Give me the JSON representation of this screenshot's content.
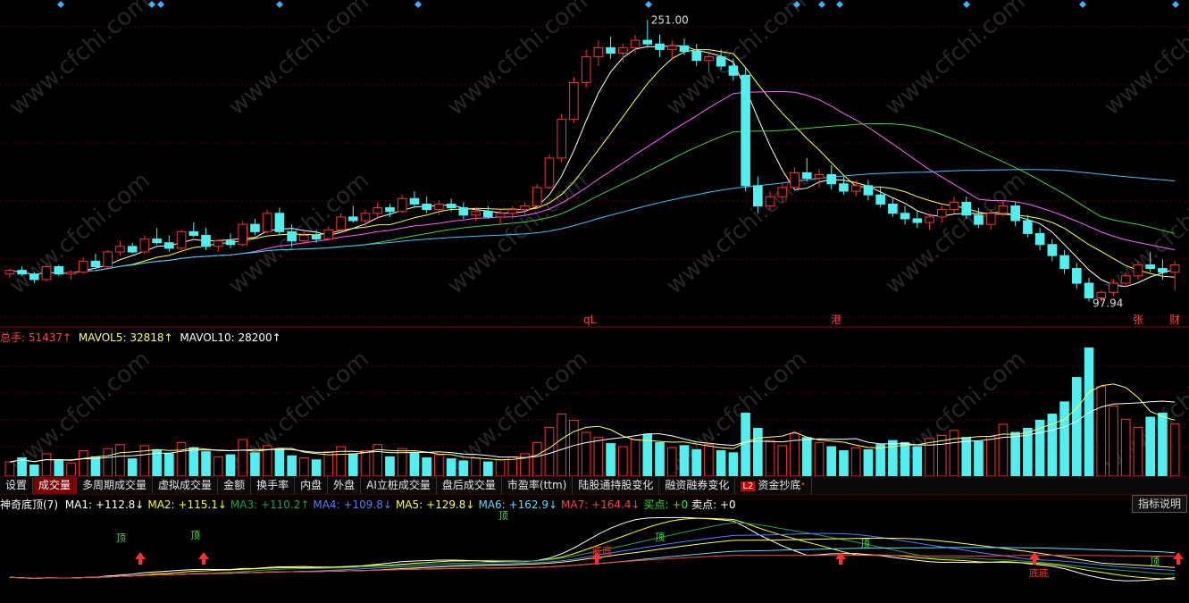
{
  "price_pane": {
    "high_label": "251.00",
    "low_label": "97.94",
    "markers": [
      {
        "text": "qL",
        "color": "#ff4040"
      },
      {
        "text": "港",
        "color": "#ff4040"
      },
      {
        "text": "张",
        "color": "#ff4040"
      },
      {
        "text": "财",
        "color": "#ff4040"
      }
    ]
  },
  "volume_legend": {
    "total": "总手: 51437↑",
    "mavol5": "MAVOL5: 32818↑",
    "mavol10": "MAVOL10: 28200↑",
    "colors": {
      "total": "#ff4040",
      "mavol5": "#ffff60",
      "mavol10": "#ffffff"
    }
  },
  "tabs": [
    {
      "label": "设置",
      "active": false
    },
    {
      "label": "成交量",
      "active": true
    },
    {
      "label": "多周期成交量",
      "active": false
    },
    {
      "label": "虚拟成交量",
      "active": false
    },
    {
      "label": "金额",
      "active": false
    },
    {
      "label": "换手率",
      "active": false
    },
    {
      "label": "内盘",
      "active": false
    },
    {
      "label": "外盘",
      "active": false
    },
    {
      "label": "AI立桩成交量",
      "active": false
    },
    {
      "label": "盘后成交量",
      "active": false
    },
    {
      "label": "市盈率(ttm)",
      "active": false
    },
    {
      "label": "陆股通持股变化",
      "active": false
    },
    {
      "label": "融资融券变化",
      "active": false
    },
    {
      "label": "资金抄底",
      "active": false,
      "badge": "L2",
      "dot": "•"
    }
  ],
  "indicator_legend": {
    "name": "神奇底顶(7)",
    "items": [
      {
        "text": "MA1: +112.8↓",
        "color": "#ffffff"
      },
      {
        "text": "MA2: +115.1↓",
        "color": "#ffff00"
      },
      {
        "text": "MA3: +110.2↑",
        "color": "#1aa05a"
      },
      {
        "text": "MA4: +109.8↓",
        "color": "#5a7bff"
      },
      {
        "text": "MA5: +129.8↓",
        "color": "#ffff60"
      },
      {
        "text": "MA6: +162.9↓",
        "color": "#60d8ff"
      },
      {
        "text": "MA7: +164.4↓",
        "color": "#ff4040"
      },
      {
        "text": "买点: +0",
        "color": "#40e040"
      },
      {
        "text": "卖点: +0",
        "color": "#ffffff"
      }
    ],
    "help_label": "指标说明"
  },
  "signal_labels": {
    "top": "顶",
    "bottom": "底",
    "bottom2": "底底"
  },
  "watermark": "www.cfchi.com",
  "colors": {
    "up": "#ff3030",
    "down": "#50f0f0",
    "ma5": "#ffffff",
    "ma10": "#ffff40",
    "ma20": "#ff60ff",
    "ma30": "#40d040",
    "ma60": "#40c0ff",
    "grid": "#5a0000"
  },
  "chart_data": [
    {
      "type": "candlestick",
      "xlabel": "",
      "ylabel": "",
      "ylim": [
        92,
        258
      ],
      "candles": [
        [
          113,
          116,
          111,
          115
        ],
        [
          115,
          117,
          112,
          113
        ],
        [
          113,
          114,
          108,
          110
        ],
        [
          110,
          118,
          109,
          117
        ],
        [
          117,
          118,
          112,
          113
        ],
        [
          113,
          115,
          110,
          114
        ],
        [
          114,
          122,
          113,
          120
        ],
        [
          120,
          124,
          116,
          117
        ],
        [
          117,
          126,
          116,
          125
        ],
        [
          125,
          131,
          123,
          128
        ],
        [
          128,
          130,
          124,
          125
        ],
        [
          125,
          134,
          124,
          132
        ],
        [
          132,
          138,
          129,
          130
        ],
        [
          130,
          134,
          125,
          127
        ],
        [
          127,
          137,
          126,
          136
        ],
        [
          136,
          141,
          133,
          134
        ],
        [
          134,
          138,
          126,
          128
        ],
        [
          128,
          132,
          125,
          131
        ],
        [
          131,
          135,
          127,
          129
        ],
        [
          129,
          142,
          128,
          140
        ],
        [
          140,
          143,
          134,
          136
        ],
        [
          136,
          148,
          135,
          146
        ],
        [
          146,
          149,
          134,
          136
        ],
        [
          136,
          140,
          128,
          131
        ],
        [
          131,
          136,
          129,
          134
        ],
        [
          134,
          137,
          130,
          132
        ],
        [
          132,
          139,
          131,
          137
        ],
        [
          137,
          146,
          136,
          144
        ],
        [
          144,
          150,
          141,
          142
        ],
        [
          142,
          148,
          138,
          146
        ],
        [
          146,
          152,
          143,
          149
        ],
        [
          149,
          151,
          144,
          147
        ],
        [
          147,
          156,
          146,
          154
        ],
        [
          154,
          158,
          149,
          151
        ],
        [
          151,
          155,
          146,
          148
        ],
        [
          148,
          153,
          145,
          151
        ],
        [
          151,
          154,
          147,
          149
        ],
        [
          149,
          152,
          143,
          145
        ],
        [
          145,
          149,
          142,
          147
        ],
        [
          147,
          150,
          143,
          144
        ],
        [
          144,
          148,
          140,
          146
        ],
        [
          146,
          150,
          143,
          148
        ],
        [
          148,
          152,
          145,
          150
        ],
        [
          150,
          162,
          149,
          160
        ],
        [
          160,
          178,
          159,
          176
        ],
        [
          176,
          200,
          174,
          197
        ],
        [
          197,
          220,
          195,
          217
        ],
        [
          217,
          235,
          214,
          231
        ],
        [
          231,
          240,
          226,
          236
        ],
        [
          236,
          242,
          230,
          233
        ],
        [
          233,
          238,
          228,
          236
        ],
        [
          236,
          243,
          233,
          240
        ],
        [
          240,
          251,
          236,
          238
        ],
        [
          238,
          243,
          231,
          235
        ],
        [
          235,
          240,
          229,
          237
        ],
        [
          237,
          241,
          232,
          234
        ],
        [
          234,
          238,
          226,
          229
        ],
        [
          229,
          234,
          223,
          231
        ],
        [
          231,
          235,
          224,
          226
        ],
        [
          226,
          230,
          218,
          221
        ],
        [
          221,
          225,
          158,
          161
        ],
        [
          161,
          166,
          146,
          150
        ],
        [
          150,
          158,
          148,
          155
        ],
        [
          155,
          163,
          152,
          160
        ],
        [
          160,
          171,
          158,
          168
        ],
        [
          168,
          176,
          163,
          165
        ],
        [
          165,
          170,
          160,
          167
        ],
        [
          167,
          172,
          159,
          162
        ],
        [
          162,
          166,
          156,
          158
        ],
        [
          158,
          164,
          155,
          161
        ],
        [
          161,
          164,
          153,
          156
        ],
        [
          156,
          160,
          149,
          151
        ],
        [
          151,
          154,
          144,
          146
        ],
        [
          146,
          150,
          140,
          143
        ],
        [
          143,
          147,
          138,
          141
        ],
        [
          141,
          146,
          137,
          144
        ],
        [
          144,
          150,
          141,
          148
        ],
        [
          148,
          155,
          146,
          152
        ],
        [
          152,
          155,
          143,
          145
        ],
        [
          145,
          149,
          138,
          140
        ],
        [
          140,
          148,
          137,
          146
        ],
        [
          146,
          153,
          144,
          150
        ],
        [
          150,
          152,
          139,
          142
        ],
        [
          142,
          145,
          133,
          135
        ],
        [
          135,
          138,
          126,
          129
        ],
        [
          129,
          132,
          120,
          123
        ],
        [
          123,
          126,
          113,
          116
        ],
        [
          116,
          119,
          105,
          108
        ],
        [
          108,
          111,
          98,
          100
        ],
        [
          100,
          104,
          98,
          103
        ],
        [
          103,
          110,
          101,
          108
        ],
        [
          108,
          114,
          106,
          112
        ],
        [
          112,
          120,
          110,
          118
        ],
        [
          118,
          125,
          114,
          116
        ],
        [
          116,
          121,
          110,
          114
        ],
        [
          114,
          120,
          104,
          118
        ]
      ]
    },
    {
      "type": "bar",
      "title": "",
      "series": [
        {
          "name": "总手",
          "values": [
            14000,
            18000,
            11000,
            22000,
            16000,
            13000,
            25000,
            19000,
            27000,
            31000,
            17000,
            30000,
            26000,
            22000,
            33000,
            28000,
            24000,
            19000,
            21000,
            36000,
            23000,
            30000,
            27000,
            20000,
            18000,
            16000,
            24000,
            29000,
            22000,
            25000,
            31000,
            19000,
            27000,
            23000,
            18000,
            21000,
            17000,
            15000,
            18000,
            14000,
            16000,
            19000,
            22000,
            33000,
            48000,
            61000,
            55000,
            43000,
            38000,
            32000,
            29000,
            36000,
            41000,
            33000,
            28000,
            30000,
            26000,
            31000,
            25000,
            23000,
            62000,
            47000,
            35000,
            30000,
            42000,
            38000,
            33000,
            29000,
            25000,
            28000,
            26000,
            31000,
            35000,
            33000,
            29000,
            37000,
            40000,
            45000,
            38000,
            34000,
            39000,
            51000,
            43000,
            47000,
            55000,
            61000,
            73000,
            97000,
            126000,
            88000,
            69000,
            56000,
            48000,
            58000,
            62000,
            51437
          ]
        }
      ],
      "ylim": [
        0,
        130000
      ]
    }
  ]
}
